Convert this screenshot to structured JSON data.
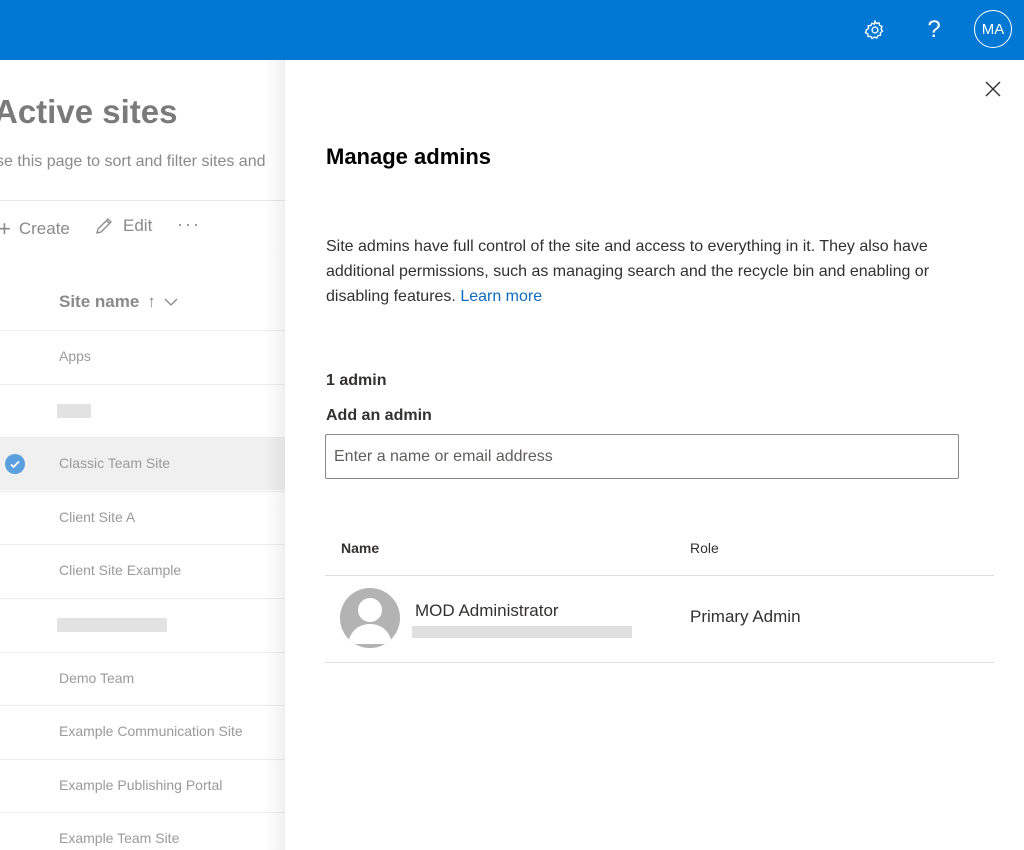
{
  "topbar": {
    "bg_color": "#0078d4",
    "settings_icon": "gear-icon",
    "help_icon": "?",
    "avatar_initials": "MA"
  },
  "background_page": {
    "title": "Active sites",
    "subtitle": "se this page to sort and filter sites and",
    "commands": {
      "create": "Create",
      "edit": "Edit",
      "more": "···"
    },
    "column_header": "Site name",
    "sort_indicator": "↑",
    "sites": [
      {
        "name": "Apps",
        "selected": false
      },
      {
        "name": "",
        "selected": false,
        "redacted": true
      },
      {
        "name": "Classic Team Site",
        "selected": true
      },
      {
        "name": "Client Site A",
        "selected": false
      },
      {
        "name": "Client Site Example",
        "selected": false
      },
      {
        "name": "",
        "selected": false,
        "redacted": true
      },
      {
        "name": "Demo Team",
        "selected": false
      },
      {
        "name": "Example Communication Site",
        "selected": false
      },
      {
        "name": "Example Publishing Portal",
        "selected": false
      },
      {
        "name": "Example Team Site",
        "selected": false
      }
    ]
  },
  "panel": {
    "title": "Manage admins",
    "description": "Site admins have full control of the site and access to everything in it. They also have additional permissions, such as managing search and the recycle bin and enabling or disabling features.",
    "learn_more": "Learn more",
    "admin_count": "1 admin",
    "add_label": "Add an admin",
    "add_placeholder": "Enter a name or email address",
    "table": {
      "headers": {
        "name": "Name",
        "role": "Role"
      },
      "rows": [
        {
          "name": "MOD Administrator",
          "role": "Primary Admin"
        }
      ]
    },
    "link_color": "#0f6cbd"
  }
}
